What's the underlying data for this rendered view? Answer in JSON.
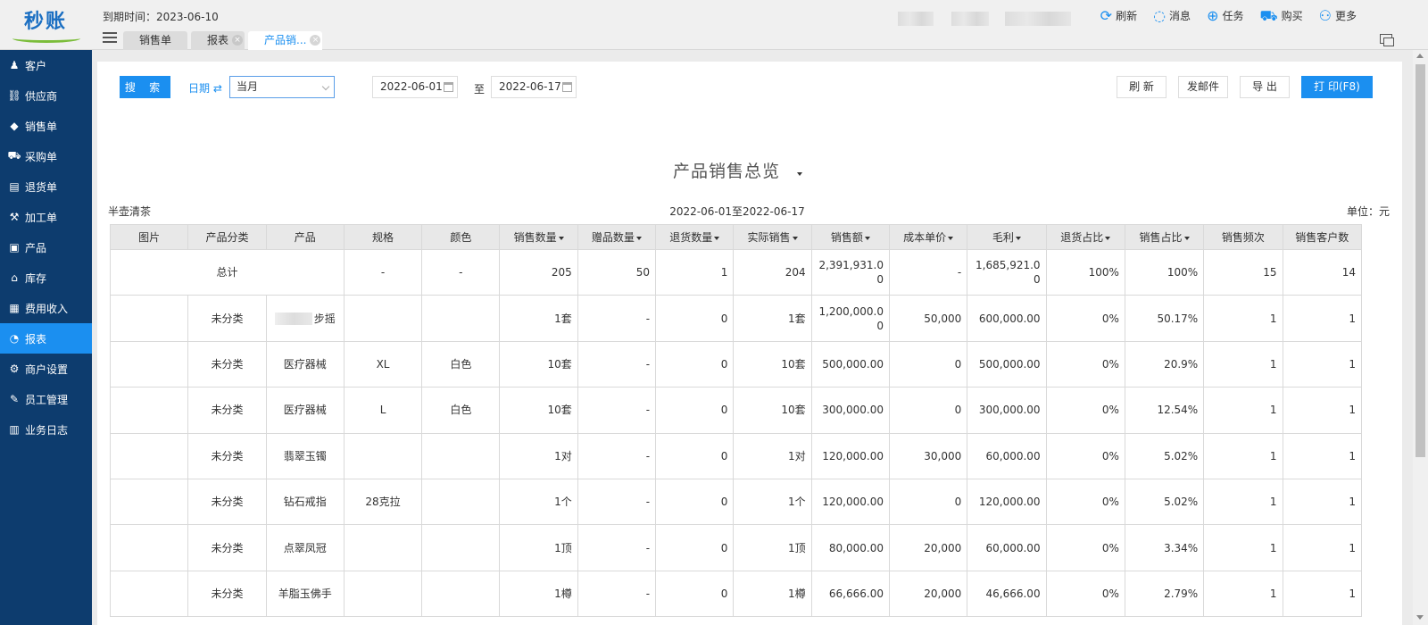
{
  "header": {
    "logo_text": "秒账",
    "expiry_label": "到期时间：2023-06-10",
    "tabs": [
      {
        "label": "销售单"
      },
      {
        "label": "报表"
      },
      {
        "label": "产品销..."
      }
    ],
    "actions": [
      {
        "label": "刷新",
        "icon": "refresh-icon",
        "glyph": "⟳"
      },
      {
        "label": "消息",
        "icon": "message-icon",
        "glyph": "◌"
      },
      {
        "label": "任务",
        "icon": "task-icon",
        "glyph": "⊕"
      },
      {
        "label": "购买",
        "icon": "cart-icon",
        "glyph": "⛟"
      },
      {
        "label": "更多",
        "icon": "user-icon",
        "glyph": "⚇"
      }
    ]
  },
  "sidebar": {
    "items": [
      {
        "label": "客户",
        "icon": "customer-icon",
        "glyph": "♟"
      },
      {
        "label": "供应商",
        "icon": "supplier-icon",
        "glyph": "⛓"
      },
      {
        "label": "销售单",
        "icon": "tag-icon",
        "glyph": "◆"
      },
      {
        "label": "采购单",
        "icon": "cart-icon",
        "glyph": "⛟"
      },
      {
        "label": "退货单",
        "icon": "return-icon",
        "glyph": "▤"
      },
      {
        "label": "加工单",
        "icon": "process-icon",
        "glyph": "⚒"
      },
      {
        "label": "产品",
        "icon": "product-icon",
        "glyph": "▣"
      },
      {
        "label": "库存",
        "icon": "warehouse-icon",
        "glyph": "⌂"
      },
      {
        "label": "费用收入",
        "icon": "expense-icon",
        "glyph": "▦"
      },
      {
        "label": "报表",
        "icon": "report-icon",
        "glyph": "◔"
      },
      {
        "label": "商户设置",
        "icon": "settings-icon",
        "glyph": "⚙"
      },
      {
        "label": "员工管理",
        "icon": "staff-icon",
        "glyph": "✎"
      },
      {
        "label": "业务日志",
        "icon": "log-icon",
        "glyph": "▥"
      }
    ],
    "active_index": 9
  },
  "toolbar": {
    "search_label": "搜 索",
    "date_label": "日期 ⇄",
    "date_range_option": "当月",
    "start_date": "2022-06-01",
    "to_label": "至",
    "end_date": "2022-06-17",
    "refresh_label": "刷 新",
    "email_label": "发邮件",
    "export_label": "导 出",
    "print_label": "打 印(F8)"
  },
  "report": {
    "title": "产品销售总览",
    "company": "半壶清茶",
    "range": "2022-06-01至2022-06-17",
    "unit": "单位：元",
    "columns": [
      {
        "label": "图片",
        "sortable": false
      },
      {
        "label": "产品分类",
        "sortable": false
      },
      {
        "label": "产品",
        "sortable": false
      },
      {
        "label": "规格",
        "sortable": false
      },
      {
        "label": "颜色",
        "sortable": false
      },
      {
        "label": "销售数量",
        "sortable": true
      },
      {
        "label": "赠品数量",
        "sortable": true
      },
      {
        "label": "退货数量",
        "sortable": true
      },
      {
        "label": "实际销售",
        "sortable": true
      },
      {
        "label": "销售额",
        "sortable": true
      },
      {
        "label": "成本单价",
        "sortable": true
      },
      {
        "label": "毛利",
        "sortable": true
      },
      {
        "label": "退货占比",
        "sortable": true
      },
      {
        "label": "销售占比",
        "sortable": true
      },
      {
        "label": "销售频次",
        "sortable": false
      },
      {
        "label": "销售客户数",
        "sortable": false
      }
    ],
    "total_row": {
      "label": "总计",
      "spec": "-",
      "color": "-",
      "sales_qty": "205",
      "gift_qty": "50",
      "return_qty": "1",
      "actual": "204",
      "amount": "2,391,931.00",
      "cost": "-",
      "profit": "1,685,921.00",
      "return_pct": "100%",
      "sales_pct": "100%",
      "freq": "15",
      "customers": "14"
    },
    "rows": [
      {
        "category": "未分类",
        "product": "步摇",
        "product_blurred": true,
        "spec": "",
        "color": "",
        "sales_qty": "1套",
        "gift_qty": "-",
        "return_qty": "0",
        "actual": "1套",
        "amount": "1,200,000.00",
        "cost": "50,000",
        "profit": "600,000.00",
        "return_pct": "0%",
        "sales_pct": "50.17%",
        "freq": "1",
        "customers": "1"
      },
      {
        "category": "未分类",
        "product": "医疗器械",
        "product_blurred": false,
        "spec": "XL",
        "color": "白色",
        "sales_qty": "10套",
        "gift_qty": "-",
        "return_qty": "0",
        "actual": "10套",
        "amount": "500,000.00",
        "cost": "0",
        "profit": "500,000.00",
        "return_pct": "0%",
        "sales_pct": "20.9%",
        "freq": "1",
        "customers": "1"
      },
      {
        "category": "未分类",
        "product": "医疗器械",
        "product_blurred": false,
        "spec": "L",
        "color": "白色",
        "sales_qty": "10套",
        "gift_qty": "-",
        "return_qty": "0",
        "actual": "10套",
        "amount": "300,000.00",
        "cost": "0",
        "profit": "300,000.00",
        "return_pct": "0%",
        "sales_pct": "12.54%",
        "freq": "1",
        "customers": "1"
      },
      {
        "category": "未分类",
        "product": "翡翠玉镯",
        "product_blurred": false,
        "spec": "",
        "color": "",
        "sales_qty": "1对",
        "gift_qty": "-",
        "return_qty": "0",
        "actual": "1对",
        "amount": "120,000.00",
        "cost": "30,000",
        "profit": "60,000.00",
        "return_pct": "0%",
        "sales_pct": "5.02%",
        "freq": "1",
        "customers": "1"
      },
      {
        "category": "未分类",
        "product": "钻石戒指",
        "product_blurred": false,
        "spec": "28克拉",
        "color": "",
        "sales_qty": "1个",
        "gift_qty": "-",
        "return_qty": "0",
        "actual": "1个",
        "amount": "120,000.00",
        "cost": "0",
        "profit": "120,000.00",
        "return_pct": "0%",
        "sales_pct": "5.02%",
        "freq": "1",
        "customers": "1"
      },
      {
        "category": "未分类",
        "product": "点翠凤冠",
        "product_blurred": false,
        "spec": "",
        "color": "",
        "sales_qty": "1顶",
        "gift_qty": "-",
        "return_qty": "0",
        "actual": "1顶",
        "amount": "80,000.00",
        "cost": "20,000",
        "profit": "60,000.00",
        "return_pct": "0%",
        "sales_pct": "3.34%",
        "freq": "1",
        "customers": "1"
      },
      {
        "category": "未分类",
        "product": "羊脂玉佛手",
        "product_blurred": false,
        "spec": "",
        "color": "",
        "sales_qty": "1樽",
        "gift_qty": "-",
        "return_qty": "0",
        "actual": "1樽",
        "amount": "66,666.00",
        "cost": "20,000",
        "profit": "46,666.00",
        "return_pct": "0%",
        "sales_pct": "2.79%",
        "freq": "1",
        "customers": "1"
      }
    ]
  },
  "colors": {
    "accent": "#1b8ff0",
    "sidebar_bg": "#0d3c6e",
    "logo_green": "#7bbd3a"
  }
}
